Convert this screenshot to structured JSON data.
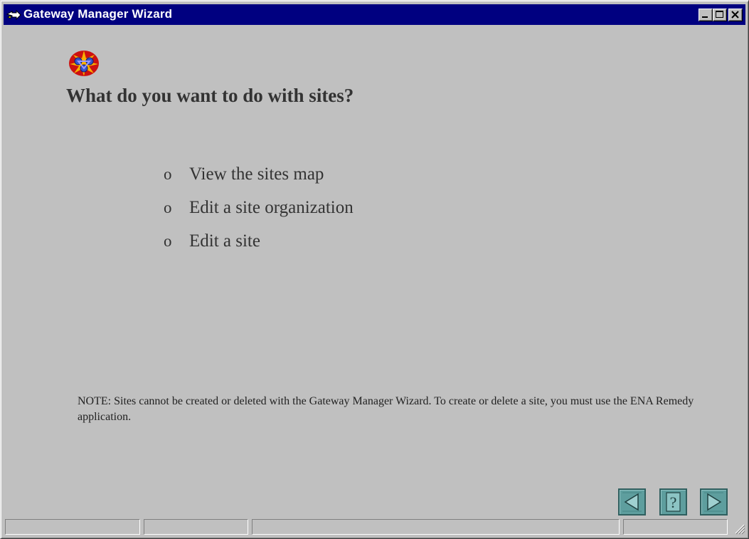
{
  "window": {
    "title": "Gateway Manager Wizard",
    "title_icon": "wizard-arrow-icon",
    "controls": {
      "minimize_icon": "minimize-icon",
      "maximize_icon": "maximize-icon",
      "close_icon": "close-icon"
    },
    "titlebar_color": "#000080"
  },
  "main": {
    "header_icon": "sites-network-icon",
    "question": "What do you want to do with sites?",
    "options": [
      {
        "bullet": "o",
        "label": "View the sites map"
      },
      {
        "bullet": "o",
        "label": "Edit a site organization"
      },
      {
        "bullet": "o",
        "label": "Edit a site"
      }
    ],
    "note": "NOTE: Sites cannot be created or deleted with the Gateway Manager Wizard. To create or delete a site, you must use the ENA Remedy application."
  },
  "navigation": {
    "back_icon": "back-arrow-icon",
    "help_icon": "help-icon",
    "help_glyph": "?",
    "next_icon": "forward-arrow-icon",
    "button_color": "#5e9e9e"
  },
  "statusbar": {
    "panes": [
      "",
      "",
      "",
      ""
    ],
    "grip_icon": "resize-grip-icon"
  }
}
